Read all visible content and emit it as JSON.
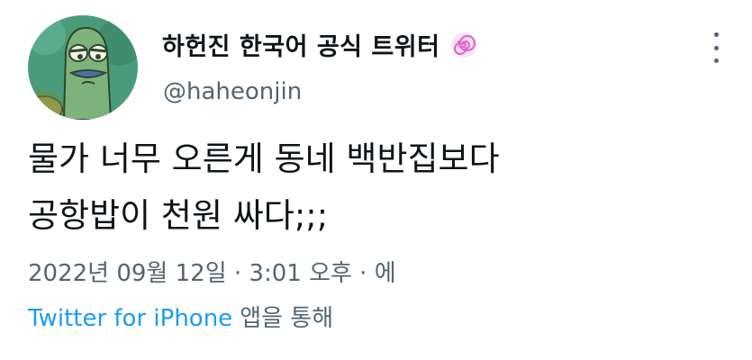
{
  "author": {
    "display_name": "하헌진 한국어 공식 트위터",
    "handle": "@haheonjin",
    "badge_icon": "spiral-emoji-icon",
    "avatar_icon": "cartoon-fish-avatar"
  },
  "tweet": {
    "lines": [
      "물가 너무 오른게 동네 백반집보다",
      "공항밥이 천원 싸다;;;"
    ]
  },
  "meta": {
    "timestamp": "2022년 09월 12일 · 3:01 오후 · 에"
  },
  "source": {
    "app_label": "Twitter for iPhone",
    "suffix": "앱을 통해"
  },
  "colors": {
    "text": "#0f1419",
    "secondary": "#536471",
    "link": "#1d9bf0"
  }
}
